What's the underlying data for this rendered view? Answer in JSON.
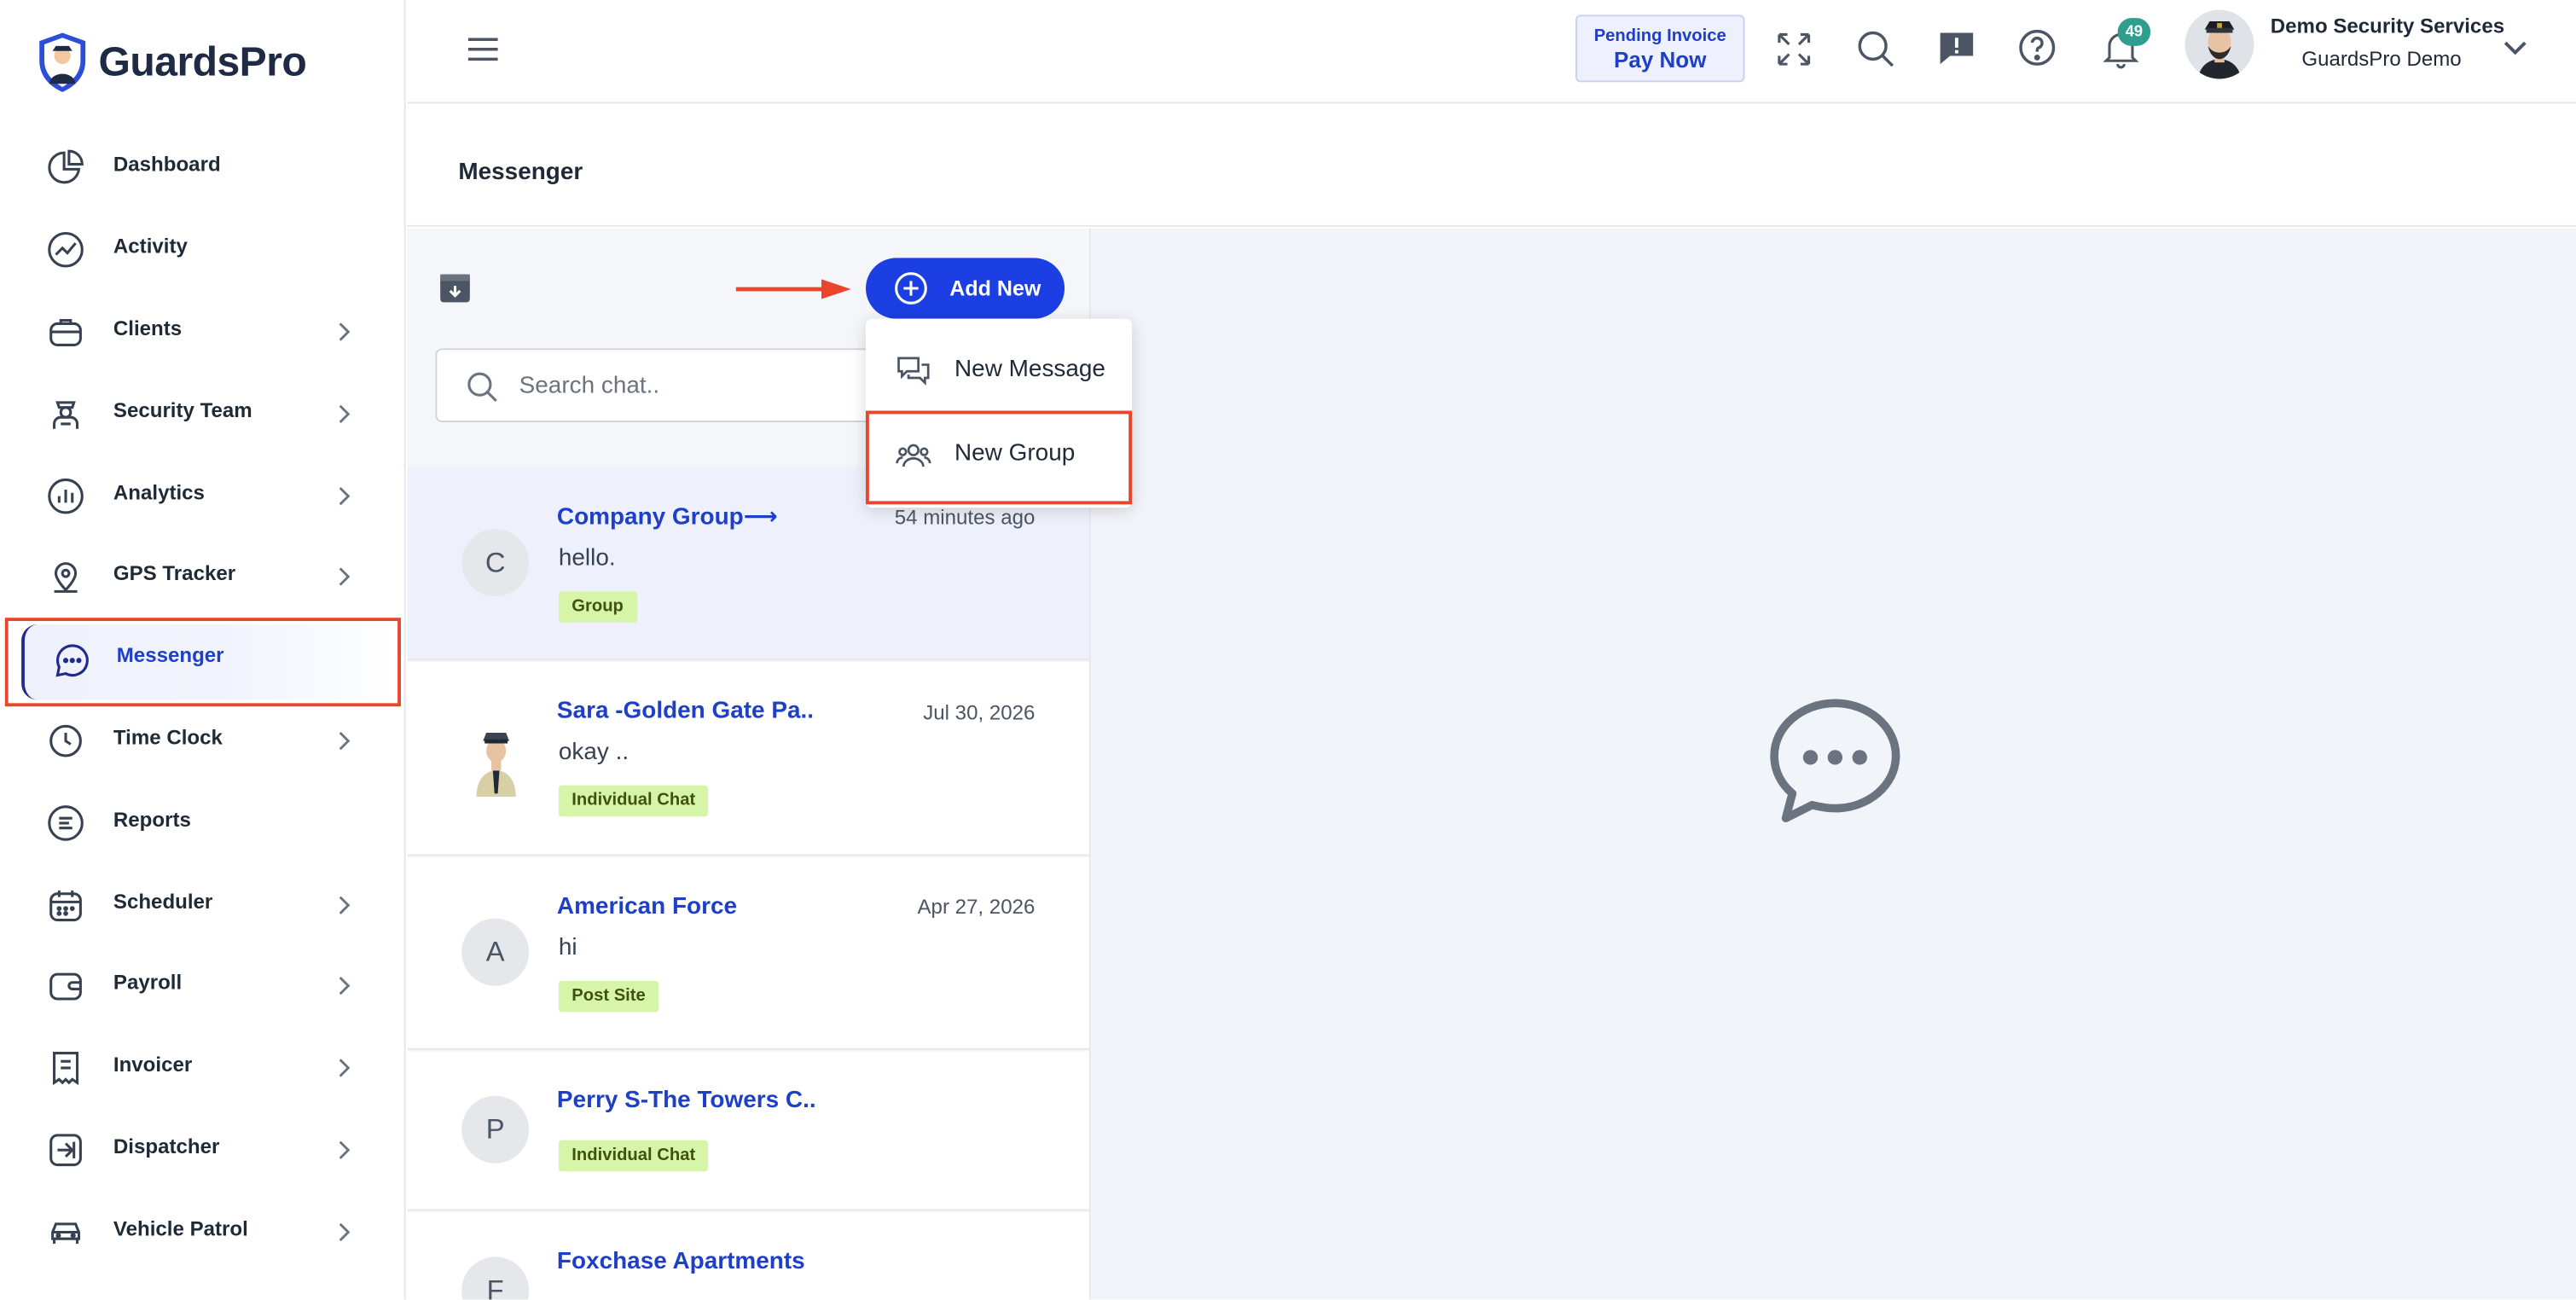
{
  "brand": {
    "name": "GuardsPro"
  },
  "sidebar": {
    "items": [
      {
        "label": "Dashboard",
        "icon": "pie-chart-icon",
        "has_children": false
      },
      {
        "label": "Activity",
        "icon": "activity-chart-icon",
        "has_children": false
      },
      {
        "label": "Clients",
        "icon": "briefcase-icon",
        "has_children": true
      },
      {
        "label": "Security Team",
        "icon": "guard-icon",
        "has_children": true
      },
      {
        "label": "Analytics",
        "icon": "bar-chart-icon",
        "has_children": true
      },
      {
        "label": "GPS Tracker",
        "icon": "map-pin-icon",
        "has_children": true
      },
      {
        "label": "Messenger",
        "icon": "chat-icon",
        "has_children": false,
        "active": true
      },
      {
        "label": "Time Clock",
        "icon": "clock-icon",
        "has_children": true
      },
      {
        "label": "Reports",
        "icon": "document-icon",
        "has_children": false
      },
      {
        "label": "Scheduler",
        "icon": "calendar-icon",
        "has_children": true
      },
      {
        "label": "Payroll",
        "icon": "wallet-icon",
        "has_children": true
      },
      {
        "label": "Invoicer",
        "icon": "receipt-icon",
        "has_children": true
      },
      {
        "label": "Dispatcher",
        "icon": "dispatch-icon",
        "has_children": true
      },
      {
        "label": "Vehicle Patrol",
        "icon": "car-icon",
        "has_children": true
      }
    ]
  },
  "header": {
    "pending_invoice_label": "Pending Invoice",
    "pay_now_label": "Pay Now",
    "notification_count": "49",
    "company_name": "Demo Security Services",
    "company_sub": "GuardsPro Demo"
  },
  "page": {
    "title": "Messenger"
  },
  "messenger": {
    "add_new_label": "Add New",
    "search_placeholder": "Search chat..",
    "dropdown": [
      {
        "label": "New Message",
        "icon": "message-bubbles-icon"
      },
      {
        "label": "New Group",
        "icon": "group-icon"
      }
    ],
    "chats": [
      {
        "initial": "C",
        "name": "Company Group⟶",
        "time": "54 minutes ago",
        "message": "hello.",
        "tag": "Group",
        "selected": true
      },
      {
        "initial": "",
        "name": "Sara -Golden Gate Pa..",
        "time": "Jul 30, 2026",
        "message": "okay ..",
        "tag": "Individual Chat",
        "selected": false
      },
      {
        "initial": "A",
        "name": "American Force",
        "time": "Apr 27, 2026",
        "message": "hi",
        "tag": "Post Site",
        "selected": false
      },
      {
        "initial": "P",
        "name": "Perry S-The Towers C..",
        "time": "",
        "message": "",
        "tag": "Individual Chat",
        "selected": false
      },
      {
        "initial": "F",
        "name": "Foxchase Apartments",
        "time": "",
        "message": "",
        "tag": "",
        "selected": false
      }
    ]
  },
  "colors": {
    "primary": "#1c3fe3",
    "highlight_box": "#e8452c",
    "tag_bg": "#d7f5a8",
    "badge": "#2f9e8f"
  }
}
